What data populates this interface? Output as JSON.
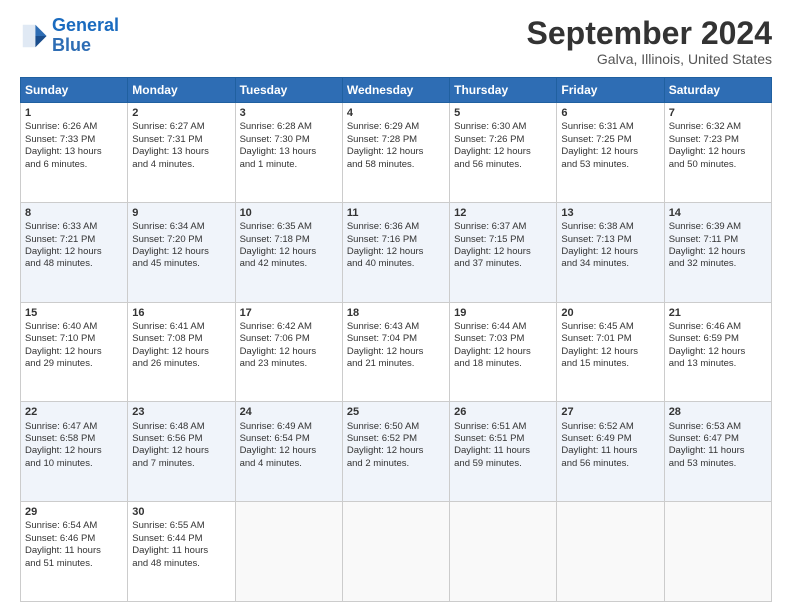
{
  "logo": {
    "line1": "General",
    "line2": "Blue"
  },
  "title": "September 2024",
  "location": "Galva, Illinois, United States",
  "days_header": [
    "Sunday",
    "Monday",
    "Tuesday",
    "Wednesday",
    "Thursday",
    "Friday",
    "Saturday"
  ],
  "weeks": [
    [
      {
        "day": "1",
        "lines": [
          "Sunrise: 6:26 AM",
          "Sunset: 7:33 PM",
          "Daylight: 13 hours",
          "and 6 minutes."
        ]
      },
      {
        "day": "2",
        "lines": [
          "Sunrise: 6:27 AM",
          "Sunset: 7:31 PM",
          "Daylight: 13 hours",
          "and 4 minutes."
        ]
      },
      {
        "day": "3",
        "lines": [
          "Sunrise: 6:28 AM",
          "Sunset: 7:30 PM",
          "Daylight: 13 hours",
          "and 1 minute."
        ]
      },
      {
        "day": "4",
        "lines": [
          "Sunrise: 6:29 AM",
          "Sunset: 7:28 PM",
          "Daylight: 12 hours",
          "and 58 minutes."
        ]
      },
      {
        "day": "5",
        "lines": [
          "Sunrise: 6:30 AM",
          "Sunset: 7:26 PM",
          "Daylight: 12 hours",
          "and 56 minutes."
        ]
      },
      {
        "day": "6",
        "lines": [
          "Sunrise: 6:31 AM",
          "Sunset: 7:25 PM",
          "Daylight: 12 hours",
          "and 53 minutes."
        ]
      },
      {
        "day": "7",
        "lines": [
          "Sunrise: 6:32 AM",
          "Sunset: 7:23 PM",
          "Daylight: 12 hours",
          "and 50 minutes."
        ]
      }
    ],
    [
      {
        "day": "8",
        "lines": [
          "Sunrise: 6:33 AM",
          "Sunset: 7:21 PM",
          "Daylight: 12 hours",
          "and 48 minutes."
        ]
      },
      {
        "day": "9",
        "lines": [
          "Sunrise: 6:34 AM",
          "Sunset: 7:20 PM",
          "Daylight: 12 hours",
          "and 45 minutes."
        ]
      },
      {
        "day": "10",
        "lines": [
          "Sunrise: 6:35 AM",
          "Sunset: 7:18 PM",
          "Daylight: 12 hours",
          "and 42 minutes."
        ]
      },
      {
        "day": "11",
        "lines": [
          "Sunrise: 6:36 AM",
          "Sunset: 7:16 PM",
          "Daylight: 12 hours",
          "and 40 minutes."
        ]
      },
      {
        "day": "12",
        "lines": [
          "Sunrise: 6:37 AM",
          "Sunset: 7:15 PM",
          "Daylight: 12 hours",
          "and 37 minutes."
        ]
      },
      {
        "day": "13",
        "lines": [
          "Sunrise: 6:38 AM",
          "Sunset: 7:13 PM",
          "Daylight: 12 hours",
          "and 34 minutes."
        ]
      },
      {
        "day": "14",
        "lines": [
          "Sunrise: 6:39 AM",
          "Sunset: 7:11 PM",
          "Daylight: 12 hours",
          "and 32 minutes."
        ]
      }
    ],
    [
      {
        "day": "15",
        "lines": [
          "Sunrise: 6:40 AM",
          "Sunset: 7:10 PM",
          "Daylight: 12 hours",
          "and 29 minutes."
        ]
      },
      {
        "day": "16",
        "lines": [
          "Sunrise: 6:41 AM",
          "Sunset: 7:08 PM",
          "Daylight: 12 hours",
          "and 26 minutes."
        ]
      },
      {
        "day": "17",
        "lines": [
          "Sunrise: 6:42 AM",
          "Sunset: 7:06 PM",
          "Daylight: 12 hours",
          "and 23 minutes."
        ]
      },
      {
        "day": "18",
        "lines": [
          "Sunrise: 6:43 AM",
          "Sunset: 7:04 PM",
          "Daylight: 12 hours",
          "and 21 minutes."
        ]
      },
      {
        "day": "19",
        "lines": [
          "Sunrise: 6:44 AM",
          "Sunset: 7:03 PM",
          "Daylight: 12 hours",
          "and 18 minutes."
        ]
      },
      {
        "day": "20",
        "lines": [
          "Sunrise: 6:45 AM",
          "Sunset: 7:01 PM",
          "Daylight: 12 hours",
          "and 15 minutes."
        ]
      },
      {
        "day": "21",
        "lines": [
          "Sunrise: 6:46 AM",
          "Sunset: 6:59 PM",
          "Daylight: 12 hours",
          "and 13 minutes."
        ]
      }
    ],
    [
      {
        "day": "22",
        "lines": [
          "Sunrise: 6:47 AM",
          "Sunset: 6:58 PM",
          "Daylight: 12 hours",
          "and 10 minutes."
        ]
      },
      {
        "day": "23",
        "lines": [
          "Sunrise: 6:48 AM",
          "Sunset: 6:56 PM",
          "Daylight: 12 hours",
          "and 7 minutes."
        ]
      },
      {
        "day": "24",
        "lines": [
          "Sunrise: 6:49 AM",
          "Sunset: 6:54 PM",
          "Daylight: 12 hours",
          "and 4 minutes."
        ]
      },
      {
        "day": "25",
        "lines": [
          "Sunrise: 6:50 AM",
          "Sunset: 6:52 PM",
          "Daylight: 12 hours",
          "and 2 minutes."
        ]
      },
      {
        "day": "26",
        "lines": [
          "Sunrise: 6:51 AM",
          "Sunset: 6:51 PM",
          "Daylight: 11 hours",
          "and 59 minutes."
        ]
      },
      {
        "day": "27",
        "lines": [
          "Sunrise: 6:52 AM",
          "Sunset: 6:49 PM",
          "Daylight: 11 hours",
          "and 56 minutes."
        ]
      },
      {
        "day": "28",
        "lines": [
          "Sunrise: 6:53 AM",
          "Sunset: 6:47 PM",
          "Daylight: 11 hours",
          "and 53 minutes."
        ]
      }
    ],
    [
      {
        "day": "29",
        "lines": [
          "Sunrise: 6:54 AM",
          "Sunset: 6:46 PM",
          "Daylight: 11 hours",
          "and 51 minutes."
        ]
      },
      {
        "day": "30",
        "lines": [
          "Sunrise: 6:55 AM",
          "Sunset: 6:44 PM",
          "Daylight: 11 hours",
          "and 48 minutes."
        ]
      },
      null,
      null,
      null,
      null,
      null
    ]
  ]
}
